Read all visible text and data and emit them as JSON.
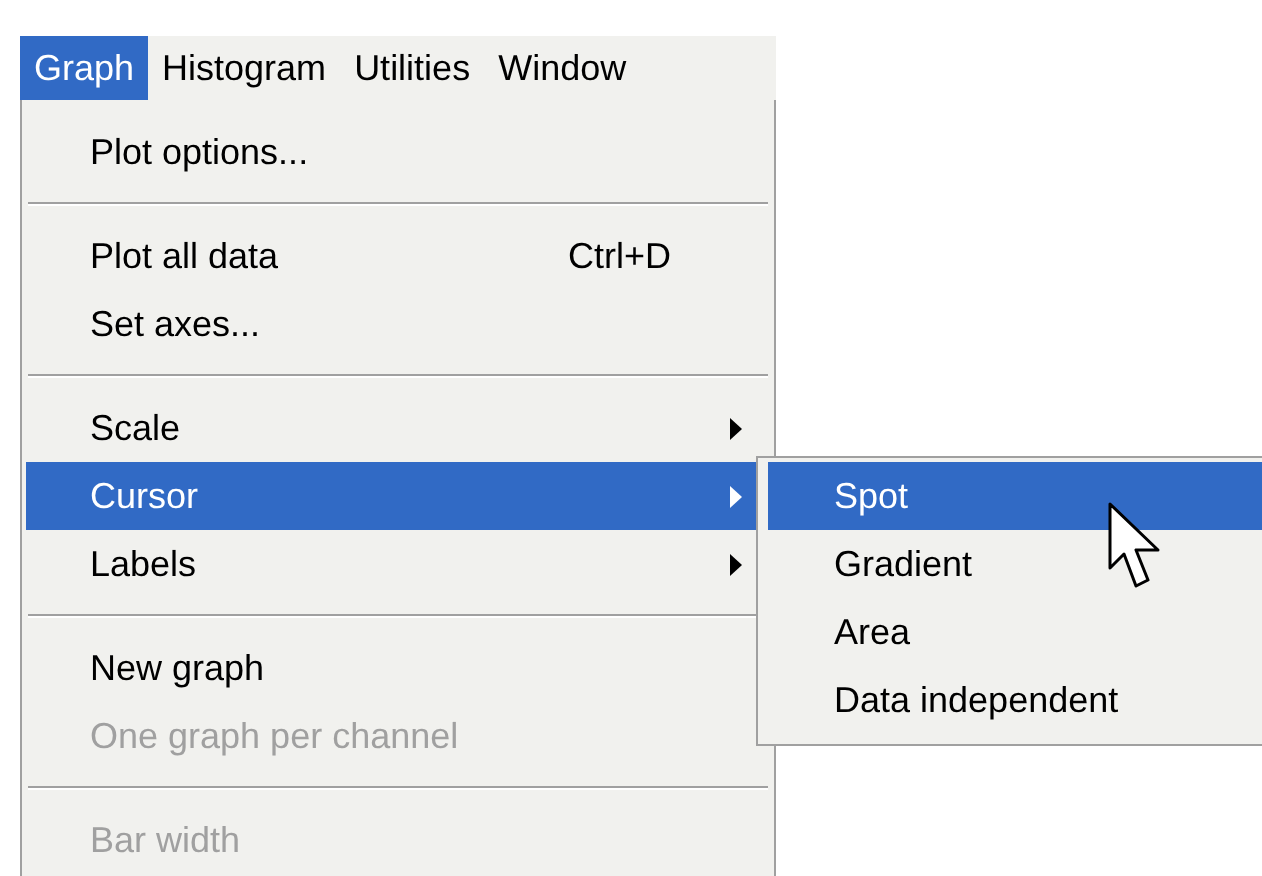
{
  "menubar": [
    {
      "label": "Graph",
      "selected": true
    },
    {
      "label": "Histogram",
      "selected": false
    },
    {
      "label": "Utilities",
      "selected": false
    },
    {
      "label": "Window",
      "selected": false
    }
  ],
  "menu": {
    "items": [
      {
        "kind": "item",
        "label": "Plot options...",
        "disabled": false,
        "selected": false
      },
      {
        "kind": "separator"
      },
      {
        "kind": "item",
        "label": "Plot all data",
        "shortcut": "Ctrl+D",
        "disabled": false,
        "selected": false
      },
      {
        "kind": "item",
        "label": "Set axes...",
        "disabled": false,
        "selected": false
      },
      {
        "kind": "separator"
      },
      {
        "kind": "submenu",
        "label": "Scale",
        "disabled": false,
        "selected": false
      },
      {
        "kind": "submenu",
        "label": "Cursor",
        "disabled": false,
        "selected": true
      },
      {
        "kind": "submenu",
        "label": "Labels",
        "disabled": false,
        "selected": false
      },
      {
        "kind": "separator"
      },
      {
        "kind": "item",
        "label": "New graph",
        "disabled": false,
        "selected": false
      },
      {
        "kind": "item",
        "label": "One graph per channel",
        "disabled": true,
        "selected": false
      },
      {
        "kind": "separator"
      },
      {
        "kind": "item",
        "label": "Bar width",
        "disabled": true,
        "selected": false
      }
    ]
  },
  "submenu": {
    "items": [
      {
        "label": "Spot",
        "selected": true
      },
      {
        "label": "Gradient",
        "selected": false
      },
      {
        "label": "Area",
        "selected": false
      },
      {
        "label": "Data independent",
        "selected": false
      }
    ]
  }
}
